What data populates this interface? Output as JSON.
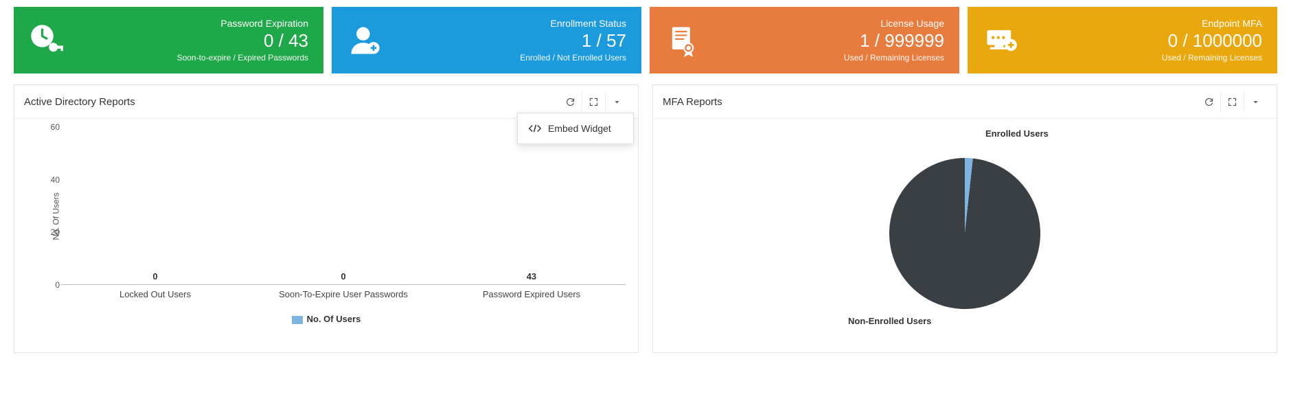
{
  "stats": [
    {
      "title": "Password Expiration",
      "value": "0 / 43",
      "sub": "Soon-to-expire / Expired Passwords",
      "color": "#1fa84a",
      "icon": "clock-key"
    },
    {
      "title": "Enrollment Status",
      "value": "1 / 57",
      "sub": "Enrolled / Not Enrolled Users",
      "color": "#1b9bdc",
      "icon": "user-plus"
    },
    {
      "title": "License Usage",
      "value": "1 / 999999",
      "sub": "Used / Remaining Licenses",
      "color": "#e87b3e",
      "icon": "certificate"
    },
    {
      "title": "Endpoint MFA",
      "value": "0 / 1000000",
      "sub": "Used / Remaining Licenses",
      "color": "#e9a80e",
      "icon": "password-device"
    }
  ],
  "panel_ad": {
    "title": "Active Directory Reports",
    "dropdown_item": "Embed Widget"
  },
  "panel_mfa": {
    "title": "MFA Reports"
  },
  "chart_data": [
    {
      "id": "ad_bar",
      "type": "bar",
      "title": "Active Directory Reports",
      "ylabel": "No. Of Users",
      "ylim": [
        0,
        60
      ],
      "yticks": [
        0,
        20,
        40,
        60
      ],
      "categories": [
        "Locked Out Users",
        "Soon-To-Expire User Passwords",
        "Password Expired Users"
      ],
      "values": [
        0,
        0,
        43
      ],
      "legend": "No. Of Users",
      "bar_color": "#7fb3e0"
    },
    {
      "id": "mfa_pie",
      "type": "pie",
      "title": "MFA Reports",
      "series": [
        {
          "name": "Enrolled Users",
          "value": 1,
          "color": "#7fb3e0"
        },
        {
          "name": "Non-Enrolled Users",
          "value": 57,
          "color": "#3a3f44"
        }
      ]
    }
  ]
}
